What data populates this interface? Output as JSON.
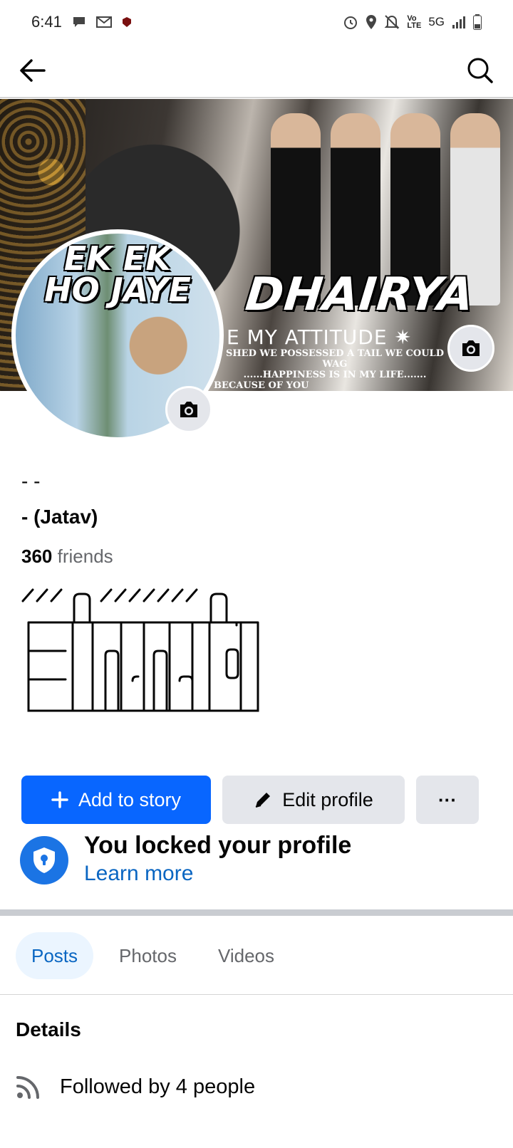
{
  "status_bar": {
    "time": "6:41",
    "network": "5G",
    "icons": [
      "chat-icon",
      "gmail-icon",
      "app-icon",
      "alarm-icon",
      "location-icon",
      "mute-icon",
      "volte-icon",
      "signal-icon",
      "battery-icon"
    ]
  },
  "app_bar": {
    "back_icon": "arrow-left-icon",
    "search_icon": "search-icon"
  },
  "cover": {
    "title": "DHAIRYA",
    "subtitle": "E MY ATTITUDE ✷",
    "tagline_1": "SHED WE POSSESSED A TAIL WE COULD WAG",
    "tagline_2": "......HAPPINESS IS IN MY LIFE.......",
    "tagline_3": "BECAUSE OF YOU"
  },
  "avatar": {
    "text_line_1": "EK EK",
    "text_line_2": "HO JAYE"
  },
  "profile": {
    "name_top": "- -",
    "name": "- (Jatav)",
    "friends_count": "360",
    "friends_label": "friends"
  },
  "actions": {
    "add_story": "Add to story",
    "edit_profile": "Edit profile",
    "more": "···"
  },
  "locked": {
    "title": "You locked your profile",
    "link": "Learn more"
  },
  "tabs": [
    {
      "label": "Posts",
      "active": true
    },
    {
      "label": "Photos",
      "active": false
    },
    {
      "label": "Videos",
      "active": false
    }
  ],
  "details": {
    "title": "Details",
    "followed_by": "Followed by 4 people"
  },
  "colors": {
    "primary_blue": "#0866ff",
    "link_blue": "#0a66c2",
    "button_gray": "#e4e6eb",
    "secondary_text": "#65676b"
  }
}
